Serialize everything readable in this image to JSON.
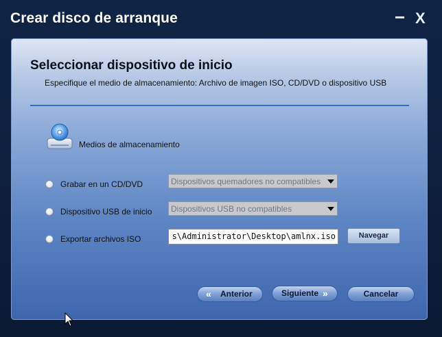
{
  "window": {
    "title": "Crear disco de arranque",
    "minimize_glyph": "−",
    "close_glyph": "X"
  },
  "header": {
    "title": "Seleccionar dispositivo de inicio",
    "subtitle": "Especifique el medio de almacenamiento: Archivo de imagen ISO, CD/DVD o dispositivo USB"
  },
  "media": {
    "icon": "disc-drive-icon",
    "label": "Medios de almacenamiento"
  },
  "options": [
    {
      "label": "Grabar en un CD/DVD",
      "select_value": "Dispositivos quemadores no compatibles"
    },
    {
      "label": "Dispositivo USB de inicio",
      "select_value": "Dispositivos USB no compatibles"
    },
    {
      "label": "Exportar archivos ISO",
      "path_value": "s\\Administrator\\Desktop\\amlnx.iso",
      "browse_label": "Navegar"
    }
  ],
  "footer": {
    "back_label": "Anterior",
    "next_label": "Siguiente",
    "cancel_label": "Cancelar"
  },
  "colors": {
    "window_bg": "#0d1f3d",
    "divider": "#2f6fd0",
    "panel_bottom": "#3e66ae"
  }
}
